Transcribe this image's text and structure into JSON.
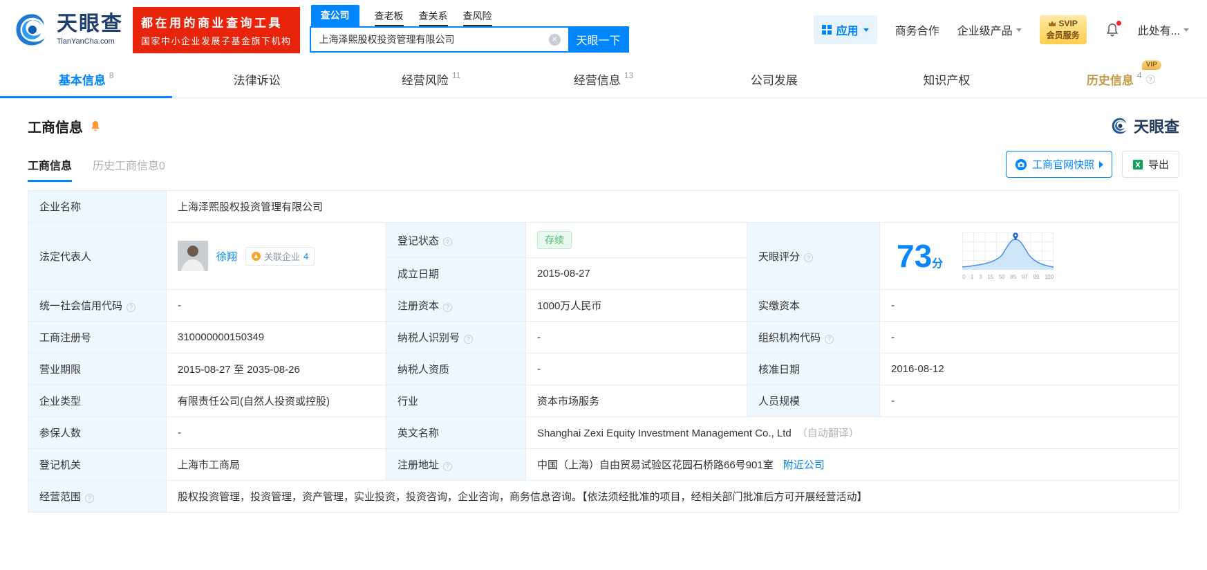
{
  "colors": {
    "accent_blue": "#0084ff",
    "brand_red": "#e8240c",
    "status_green": "#4cb86e",
    "history_gold": "#c49a4a"
  },
  "header": {
    "logo_cn": "天眼查",
    "logo_en": "TianYanCha.com",
    "slogan_line1": "都在用的商业查询工具",
    "slogan_line2": "国家中小企业发展子基金旗下机构",
    "search_tabs": [
      "查公司",
      "查老板",
      "查关系",
      "查风险"
    ],
    "search_value": "上海泽熙股权投资管理有限公司",
    "search_button": "天眼一下",
    "app_menu": "应用",
    "nav_cooperation": "商务合作",
    "nav_enterprise": "企业级产品",
    "vip_line1": "SVIP",
    "vip_line2": "会员服务",
    "user_menu": "此处有..."
  },
  "tabs": [
    {
      "label": "基本信息",
      "count": "8"
    },
    {
      "label": "法律诉讼",
      "count": ""
    },
    {
      "label": "经营风险",
      "count": "11"
    },
    {
      "label": "经营信息",
      "count": "13"
    },
    {
      "label": "公司发展",
      "count": ""
    },
    {
      "label": "知识产权",
      "count": ""
    },
    {
      "label": "历史信息",
      "count": "4"
    }
  ],
  "history_vip": "VIP",
  "section": {
    "title": "工商信息",
    "watermark": "天眼查",
    "subtab_active": "工商信息",
    "subtab_history": "历史工商信息0",
    "snapshot_button": "工商官网快照",
    "export_button": "导出"
  },
  "fields": {
    "company_name_label": "企业名称",
    "company_name": "上海泽熙股权投资管理有限公司",
    "legal_rep_label": "法定代表人",
    "legal_rep_name": "徐翔",
    "related_label": "关联企业",
    "related_count": "4",
    "status_label": "登记状态",
    "status_value": "存续",
    "established_label": "成立日期",
    "established_value": "2015-08-27",
    "score_label": "天眼评分",
    "score_value": "73",
    "score_unit": "分",
    "credit_code_label": "统一社会信用代码",
    "credit_code_value": "-",
    "reg_capital_label": "注册资本",
    "reg_capital_value": "1000万人民币",
    "paid_capital_label": "实缴资本",
    "paid_capital_value": "-",
    "reg_number_label": "工商注册号",
    "reg_number_value": "310000000150349",
    "taxpayer_id_label": "纳税人识别号",
    "taxpayer_id_value": "-",
    "org_code_label": "组织机构代码",
    "org_code_value": "-",
    "business_term_label": "营业期限",
    "business_term_value": "2015-08-27 至 2035-08-26",
    "taxpayer_quality_label": "纳税人资质",
    "taxpayer_quality_value": "-",
    "approval_date_label": "核准日期",
    "approval_date_value": "2016-08-12",
    "company_type_label": "企业类型",
    "company_type_value": "有限责任公司(自然人投资或控股)",
    "industry_label": "行业",
    "industry_value": "资本市场服务",
    "staff_size_label": "人员规模",
    "staff_size_value": "-",
    "insured_label": "参保人数",
    "insured_value": "-",
    "english_name_label": "英文名称",
    "english_name_value": "Shanghai Zexi Equity Investment Management Co., Ltd",
    "english_name_note": "（自动翻译）",
    "reg_authority_label": "登记机关",
    "reg_authority_value": "上海市工商局",
    "address_label": "注册地址",
    "address_value": "中国（上海）自由贸易试验区花园石桥路66号901室",
    "address_link": "附近公司",
    "business_scope_label": "经营范围",
    "business_scope_value": "股权投资管理，投资管理，资产管理，实业投资，投资咨询，企业咨询，商务信息咨询。【依法须经批准的项目，经相关部门批准后方可开展经营活动】"
  },
  "chart_data": {
    "type": "area",
    "title": "天眼评分",
    "score": 73,
    "score_unit": "分",
    "x_ticks": [
      0,
      1,
      3,
      15,
      50,
      85,
      97,
      99,
      100
    ],
    "description": "Bell-curve score distribution with location pin marker at score 73",
    "curve_color": "#4a90e2",
    "fill_color": "#cfe5fa",
    "grid": true
  }
}
